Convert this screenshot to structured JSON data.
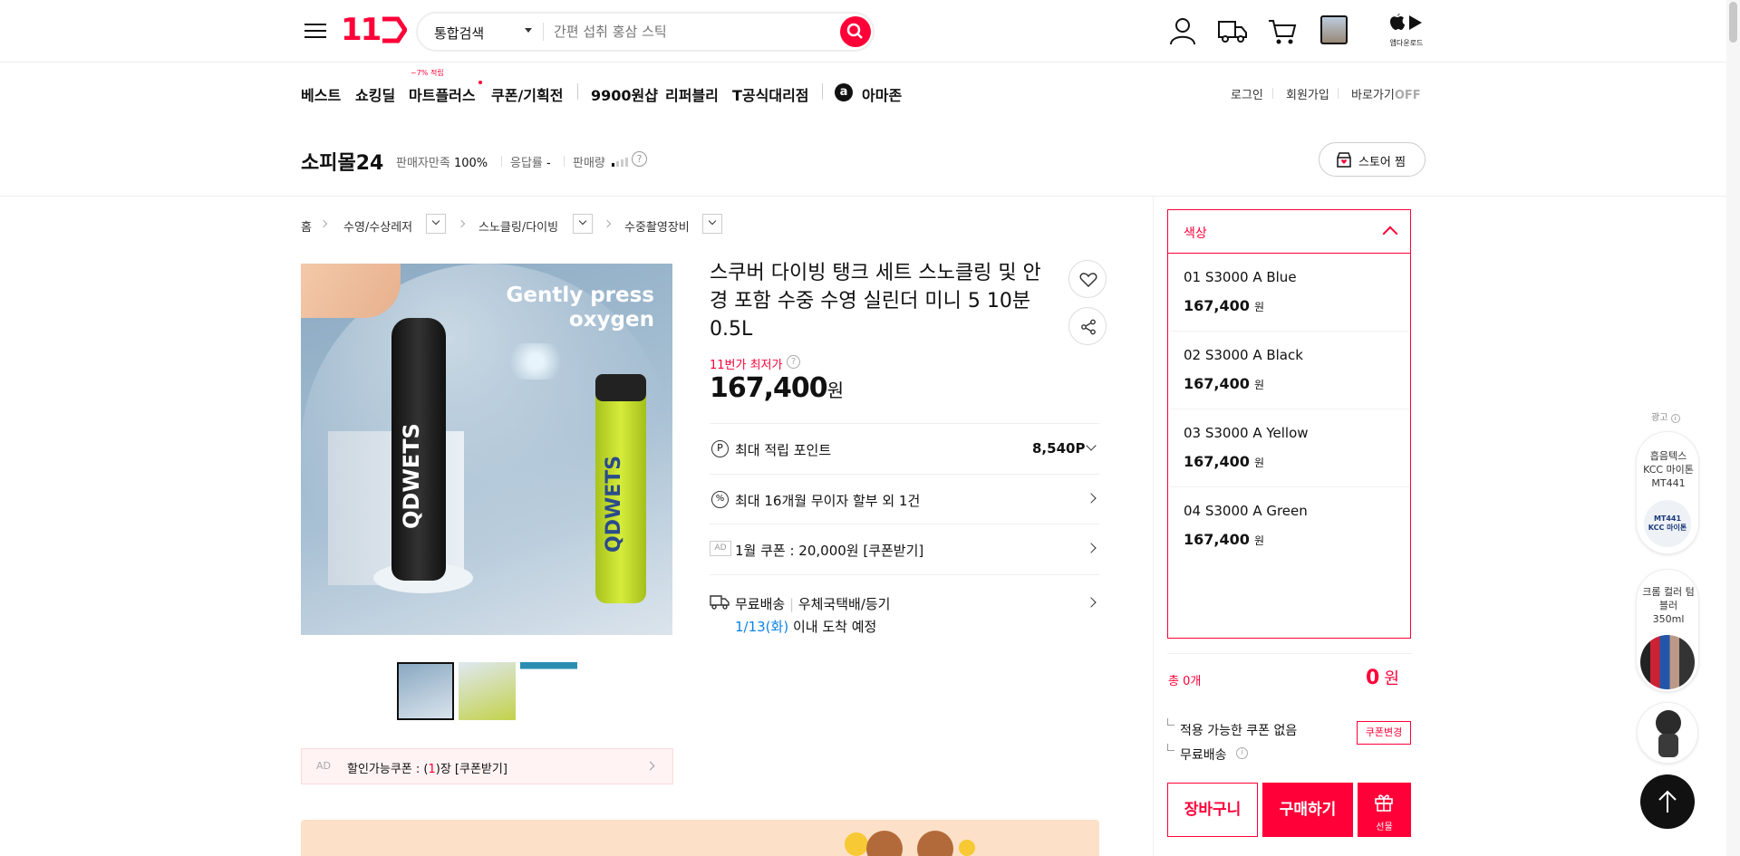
{
  "header": {
    "logo": "11",
    "search_scope": "통합검색",
    "search_placeholder": "간편 섭취 홍삼 스틱",
    "app_download": "앱다운로드"
  },
  "gnb": {
    "items": [
      "베스트",
      "쇼킹딜",
      "마트플러스",
      "쿠폰/기획전",
      "9900원샵",
      "리퍼블리",
      "T공식대리점",
      "아마존"
    ],
    "mart_badge": "~7% 적립",
    "login": "로그인",
    "signup": "회원가입",
    "shortcut": "바로가기",
    "shortcut_state": "OFF"
  },
  "seller": {
    "name": "소피몰24",
    "satisfaction_label": "판매자만족",
    "satisfaction_value": "100%",
    "response_label": "응답률",
    "response_value": "-",
    "sales_label": "판매량",
    "store_fav": "스토어 찜"
  },
  "breadcrumb": [
    "홈",
    "수영/수상레저",
    "스노클링/다이빙",
    "수중촬영장비"
  ],
  "product": {
    "title": "스쿠버 다이빙 탱크 세트 스노클링 및 안경 포함 수중 수영 실린더 미니 5 10분 0.5L",
    "lowest_label": "11번가 최저가",
    "price": "167,400",
    "price_unit": "원",
    "image_caption_1": "Gently press",
    "image_caption_2": "oxygen",
    "brand_print": "QDWETS",
    "point_label": "최대 적립 포인트",
    "point_value": "8,540P",
    "installment": "최대 16개월 무이자 할부 외 1건",
    "ad_badge": "AD",
    "coupon_row": "1월 쿠폰 : 20,000원 [쿠폰받기]",
    "delivery_free": "무료배송",
    "delivery_method": "우체국택배/등기",
    "delivery_date": "1/13(화)",
    "delivery_suffix": "이내 도착 예정",
    "discount_coupon_prefix": "할인가능쿠폰 : (",
    "discount_coupon_count": "1",
    "discount_coupon_suffix": ")장 [쿠폰받기]"
  },
  "options": {
    "header": "색상",
    "items": [
      {
        "name": "01 S3000 A Blue",
        "price": "167,400",
        "unit": "원"
      },
      {
        "name": "02 S3000 A Black",
        "price": "167,400",
        "unit": "원"
      },
      {
        "name": "03 S3000 A Yellow",
        "price": "167,400",
        "unit": "원"
      },
      {
        "name": "04 S3000 A Green",
        "price": "167,400",
        "unit": "원"
      }
    ]
  },
  "summary": {
    "total_label": "총 0개",
    "total_value": "0",
    "total_unit": "원",
    "no_coupon": "적용 가능한 쿠폰 없음",
    "coupon_change": "쿠폰변경",
    "free_delivery": "무료배송",
    "cart": "장바구니",
    "buy": "구매하기",
    "gift": "선물"
  },
  "side_ads": {
    "label": "광고",
    "ad1": "흡음텍스 KCC 마이톤 MT441",
    "ad1_chip_1": "MT441",
    "ad1_chip_2": "KCC 마이톤",
    "ad2": "크롬 컬러 텀블러 350ml"
  },
  "colors": {
    "accent": "#ff0038",
    "blue": "#0b83e6"
  }
}
